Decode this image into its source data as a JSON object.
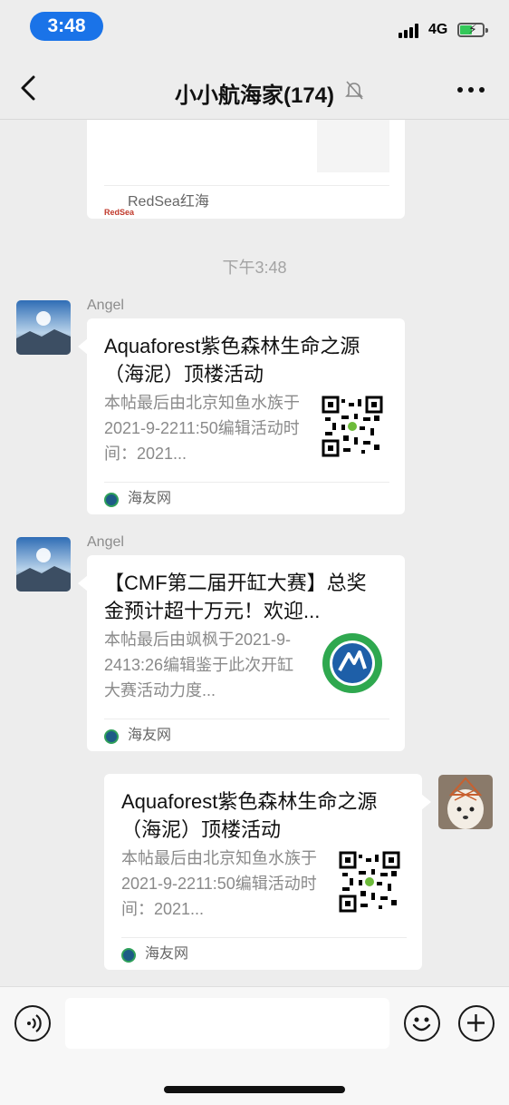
{
  "status_bar": {
    "time": "3:48",
    "network": "4G"
  },
  "nav": {
    "title": "小小航海家(174)"
  },
  "messages": [
    {
      "source": "RedSea红海",
      "source_logo_text": "RedSea"
    },
    {
      "timestamp": "下午3:48"
    },
    {
      "sender": "Angel",
      "title": "Aquaforest紫色森林生命之源（海泥）顶楼活动",
      "desc": "本帖最后由北京知鱼水族于2021-9-2211:50编辑活动时间：2021...",
      "source": "海友网"
    },
    {
      "sender": "Angel",
      "title": "【CMF第二届开缸大赛】总奖金预计超十万元！欢迎...",
      "desc": "本帖最后由飒枫于2021-9-2413:26编辑鉴于此次开缸大赛活动力度...",
      "source": "海友网"
    },
    {
      "title": "Aquaforest紫色森林生命之源（海泥）顶楼活动",
      "desc": "本帖最后由北京知鱼水族于2021-9-2211:50编辑活动时间：2021...",
      "source": "海友网"
    }
  ],
  "icons": {
    "back": "chevron-left-icon",
    "mute": "bell-slash-icon",
    "more": "ellipsis-icon",
    "voice": "voice-icon",
    "emoji": "emoji-icon",
    "plus": "plus-icon"
  },
  "colors": {
    "background": "#ededed",
    "card": "#ffffff",
    "time_pill": "#1a73e8",
    "battery": "#34c759"
  }
}
